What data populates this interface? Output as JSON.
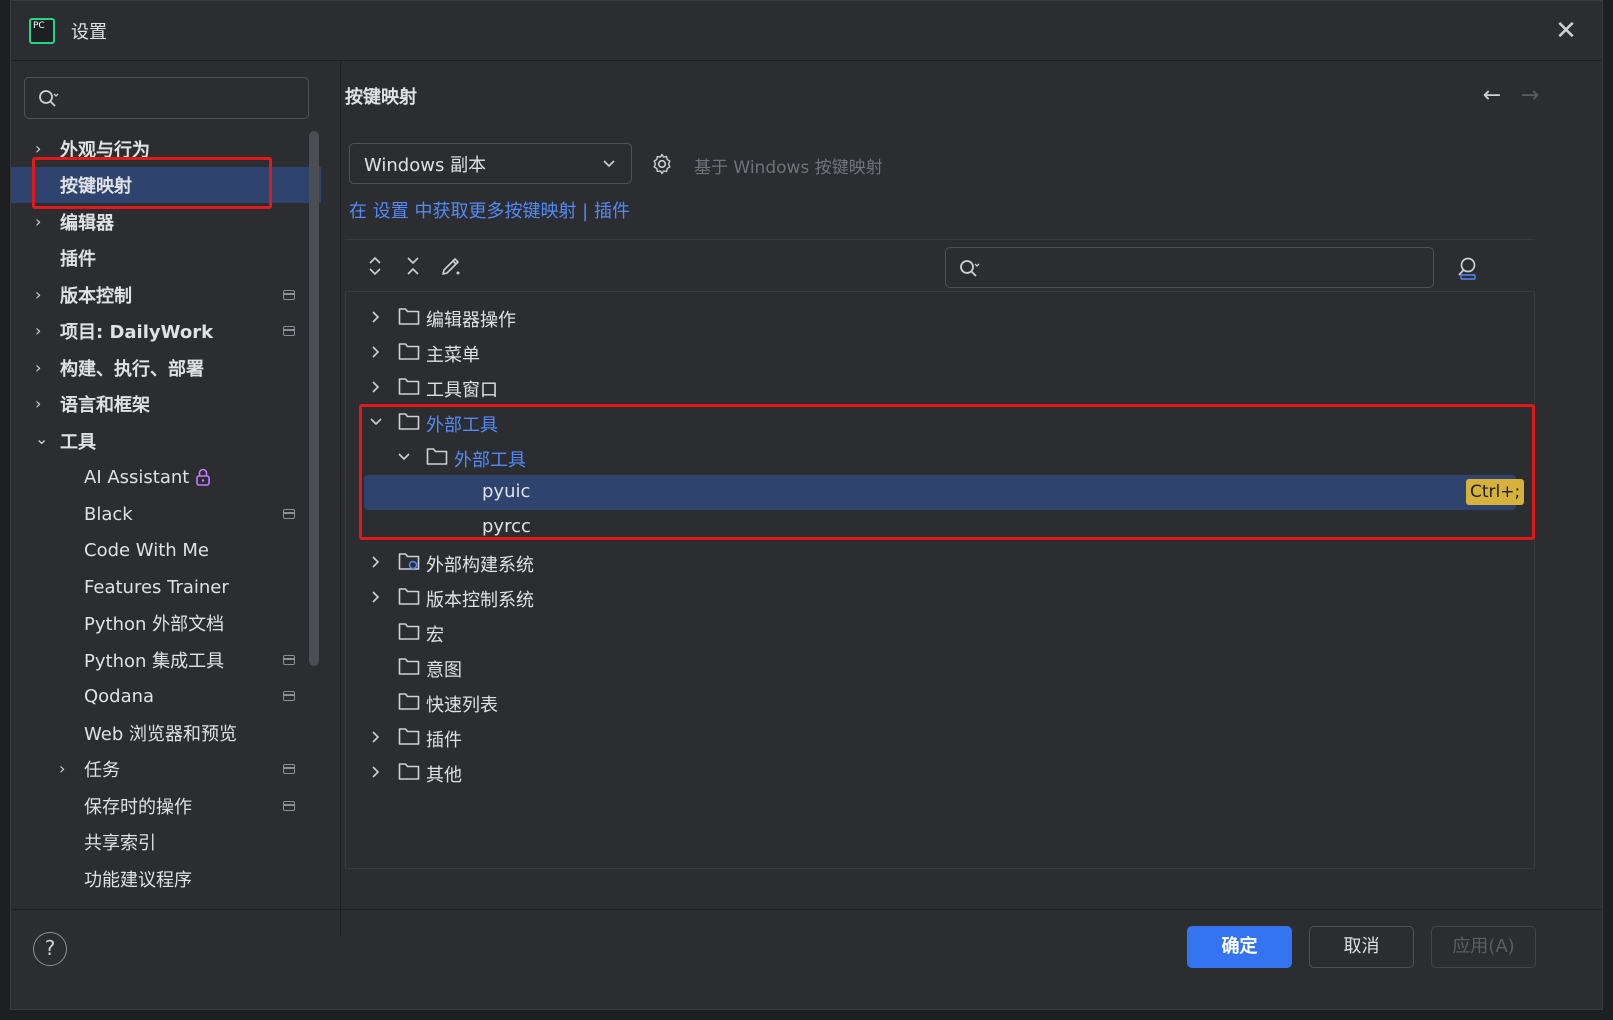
{
  "window": {
    "title": "设置",
    "close_glyph": "✕"
  },
  "sidebar": {
    "search_placeholder": "",
    "items": [
      {
        "label": "外观与行为",
        "chevron": "›",
        "bold": true
      },
      {
        "label": "按键映射",
        "chevron": "",
        "bold": true
      },
      {
        "label": "编辑器",
        "chevron": "›",
        "bold": true
      },
      {
        "label": "插件",
        "chevron": "",
        "bold": true
      },
      {
        "label": "版本控制",
        "chevron": "›",
        "bold": true
      },
      {
        "label": "项目: DailyWork",
        "chevron": "›",
        "bold": true
      },
      {
        "label": "构建、执行、部署",
        "chevron": "›",
        "bold": true
      },
      {
        "label": "语言和框架",
        "chevron": "›",
        "bold": true
      },
      {
        "label": "工具",
        "chevron": "⌄",
        "bold": true
      },
      {
        "label": "AI Assistant"
      },
      {
        "label": "Black"
      },
      {
        "label": "Code With Me"
      },
      {
        "label": "Features Trainer"
      },
      {
        "label": "Python 外部文档"
      },
      {
        "label": "Python 集成工具"
      },
      {
        "label": "Qodana"
      },
      {
        "label": "Web 浏览器和预览"
      },
      {
        "label": "任务",
        "chevron": "›"
      },
      {
        "label": "保存时的操作"
      },
      {
        "label": "共享索引"
      },
      {
        "label": "功能建议程序"
      }
    ]
  },
  "main": {
    "title": "按键映射",
    "nav_back": "←",
    "nav_forward": "→",
    "keymap_selected": "Windows 副本",
    "based_on": "基于 Windows 按键映射",
    "get_more_text": "在 设置 中获取更多按键映射 | 插件",
    "tree_search_placeholder": ""
  },
  "tree": [
    {
      "label": "编辑器操作"
    },
    {
      "label": "主菜单"
    },
    {
      "label": "工具窗口"
    },
    {
      "label": "外部工具"
    },
    {
      "label": "外部工具"
    },
    {
      "label": "pyuic",
      "shortcut": "Ctrl+;"
    },
    {
      "label": "pyrcc"
    },
    {
      "label": "外部构建系统"
    },
    {
      "label": "版本控制系统"
    },
    {
      "label": "宏"
    },
    {
      "label": "意图"
    },
    {
      "label": "快速列表"
    },
    {
      "label": "插件"
    },
    {
      "label": "其他"
    }
  ],
  "footer": {
    "help": "?",
    "ok": "确定",
    "cancel": "取消",
    "apply": "应用(A)"
  },
  "colors": {
    "accent": "#3574f0",
    "link": "#548af7",
    "selection": "#2e436e",
    "annotation": "#e0191b",
    "shortcut_badge": "#d6b23a"
  }
}
